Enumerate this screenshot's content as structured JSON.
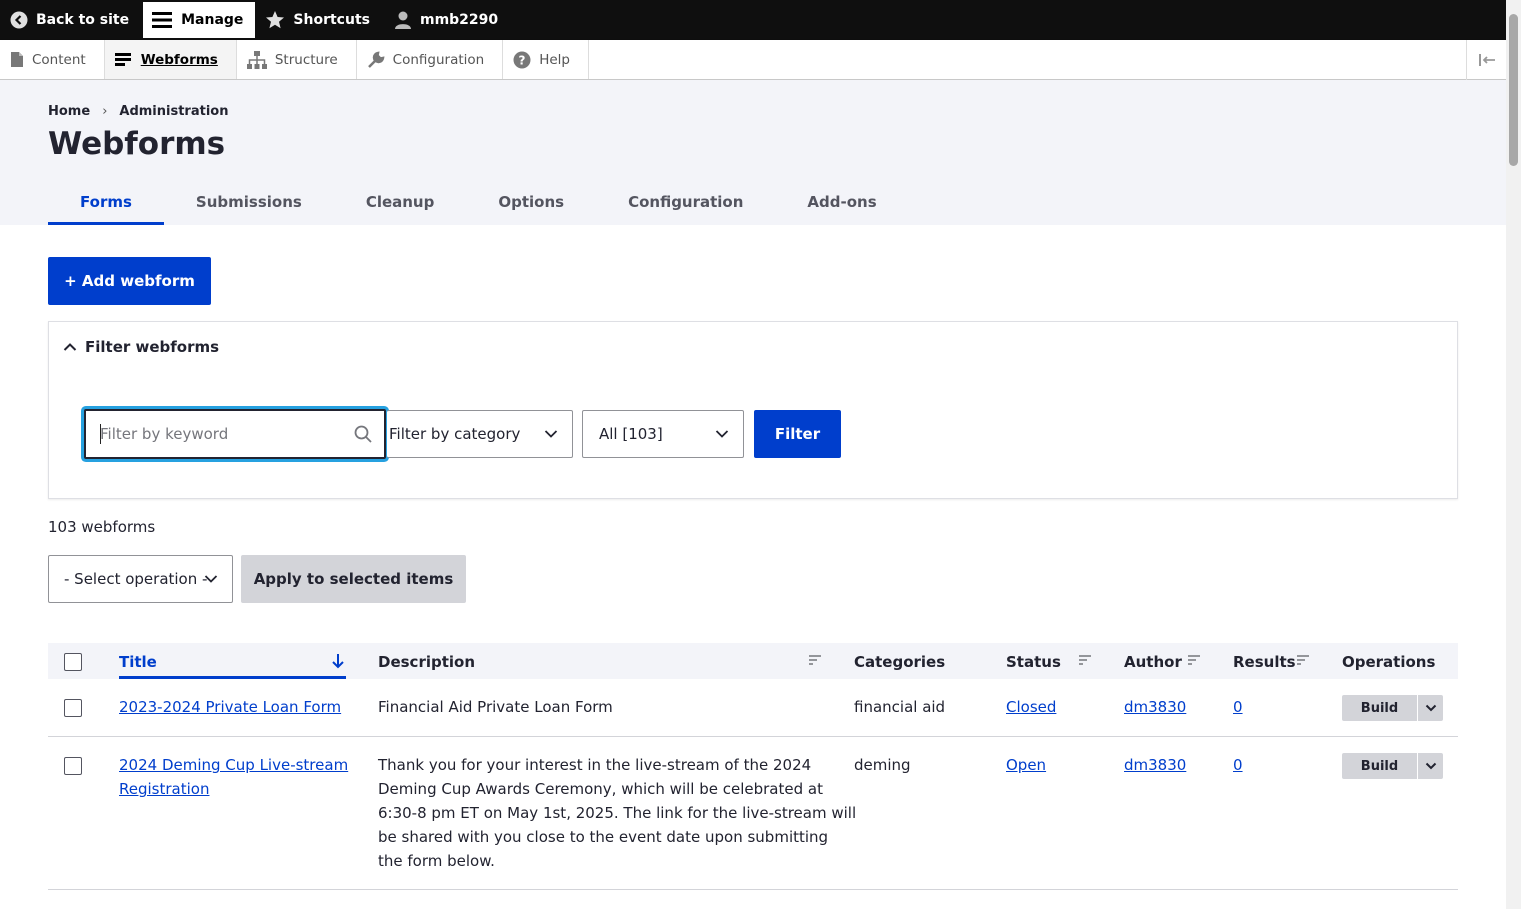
{
  "toolbar": {
    "back_label": "Back to site",
    "manage_label": "Manage",
    "shortcuts_label": "Shortcuts",
    "user_label": "mmb2290"
  },
  "tray": {
    "items": [
      {
        "label": "Content",
        "icon": "file-icon"
      },
      {
        "label": "Webforms",
        "icon": "webform-icon"
      },
      {
        "label": "Structure",
        "icon": "sitemap-icon"
      },
      {
        "label": "Configuration",
        "icon": "wrench-icon"
      },
      {
        "label": "Help",
        "icon": "help-icon"
      }
    ]
  },
  "breadcrumb": {
    "items": [
      "Home",
      "Administration"
    ],
    "separator": "›"
  },
  "page": {
    "title": "Webforms"
  },
  "tabs": [
    "Forms",
    "Submissions",
    "Cleanup",
    "Options",
    "Configuration",
    "Add-ons"
  ],
  "actions": {
    "add_webform": "+ Add webform"
  },
  "filter": {
    "summary": "Filter webforms",
    "keyword_placeholder": "Filter by keyword",
    "category_value": "Filter by category",
    "state_value": "All [103]",
    "submit_label": "Filter"
  },
  "results": {
    "count_text": "103 webforms"
  },
  "bulk": {
    "operation_value": "- Select operation -",
    "apply_label": "Apply to selected items"
  },
  "table": {
    "headers": {
      "title": "Title",
      "description": "Description",
      "categories": "Categories",
      "status": "Status",
      "author": "Author",
      "results": "Results",
      "operations": "Operations"
    },
    "rows": [
      {
        "title_line1": "2023-2024 Private Loan Form",
        "title_line2": "",
        "description": [
          "Financial Aid Private Loan Form"
        ],
        "category": "financial aid",
        "status": "Closed",
        "author": "dm3830",
        "results": "0",
        "op_label": "Build"
      },
      {
        "title_line1": "2024 Deming Cup Live-stream",
        "title_line2": "Registration",
        "description": [
          "Thank you for your interest in the live-stream of the 2024",
          "Deming Cup Awards Ceremony, which will be celebrated at",
          "6:30-8 pm ET on May 1st, 2025. The link for the live-stream will",
          "be shared with you close to the event date upon submitting",
          "the form below."
        ],
        "category": "deming",
        "status": "Open",
        "author": "dm3830",
        "results": "0",
        "op_label": "Build"
      }
    ]
  },
  "colors": {
    "primary": "#003ecc",
    "toolbar_bg": "#0f0f0f",
    "header_bg": "#f3f4f9",
    "focus_ring": "#26a1e0"
  }
}
